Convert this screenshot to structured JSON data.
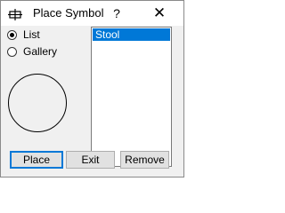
{
  "window": {
    "title": "Place Symbol",
    "help_glyph": "?",
    "close_glyph": "✕"
  },
  "view_options": [
    {
      "label": "List",
      "selected": true
    },
    {
      "label": "Gallery",
      "selected": false
    }
  ],
  "symbol_list": {
    "items": [
      "Stool"
    ],
    "selected": "Stool"
  },
  "buttons": {
    "place": "Place",
    "exit": "Exit",
    "remove": "Remove"
  },
  "colors": {
    "selection": "#0078d7",
    "default_button_border": "#0078d7"
  },
  "icons": {
    "app_icon": "place-symbol-icon",
    "preview": "circle-symbol-preview"
  }
}
